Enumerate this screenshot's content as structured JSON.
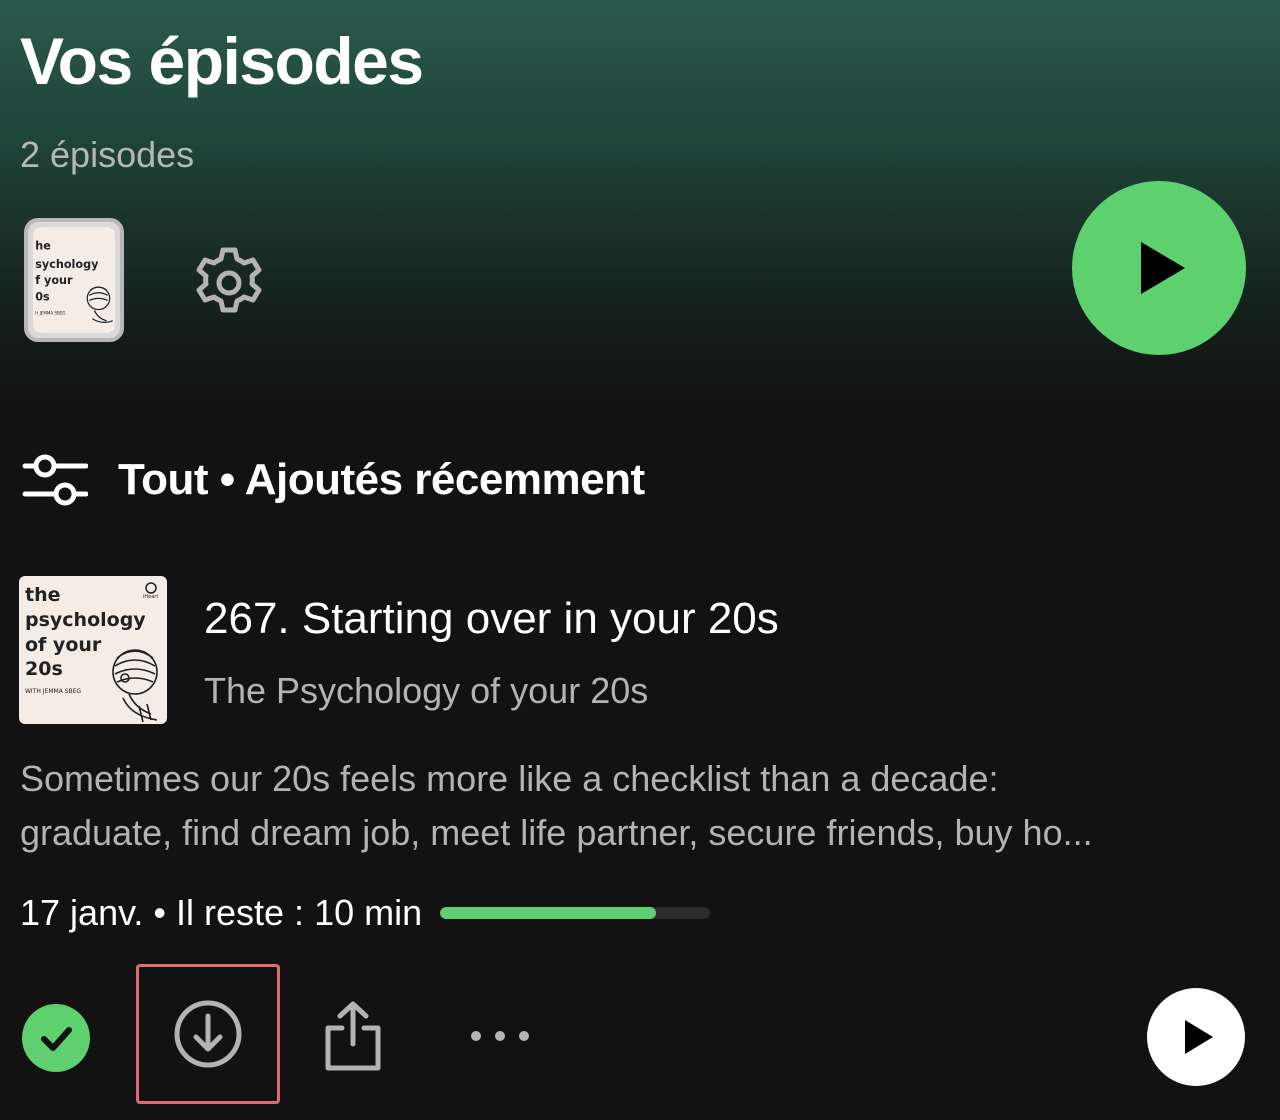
{
  "header": {
    "title": "Vos épisodes",
    "subtitle": "2 épisodes"
  },
  "actions": {
    "cover_icon": "podcast-cover-icon",
    "settings_icon": "gear-icon",
    "play_all_icon": "play-icon"
  },
  "filter": {
    "icon": "sliders-icon",
    "label": "Tout • Ajoutés récemment"
  },
  "episode": {
    "cover_text": [
      "the",
      "psychology",
      "of your",
      "20s"
    ],
    "cover_byline": "WITH JEMMA SBEG",
    "cover_small_text": [
      "he",
      "sychology",
      "f your",
      "0s"
    ],
    "cover_small_byline": "H JEMMA SBEG",
    "cover_badge": "iHeart",
    "title": "267. Starting over in your 20s",
    "show": "The Psychology of your 20s",
    "description_lines": [
      "Sometimes our 20s feels more like a checklist than a decade:",
      "graduate, find dream job, meet life partner, secure friends, buy ho..."
    ],
    "meta": "17 janv. • Il reste : 10 min",
    "progress": 0.8
  },
  "episode_actions": {
    "played_icon": "check-icon",
    "download_icon": "download-icon",
    "share_icon": "share-icon",
    "more_icon": "more-icon",
    "play_icon": "play-icon"
  },
  "colors": {
    "accent": "#5ed06e",
    "background": "#121212",
    "highlight_border": "#e06a70"
  }
}
